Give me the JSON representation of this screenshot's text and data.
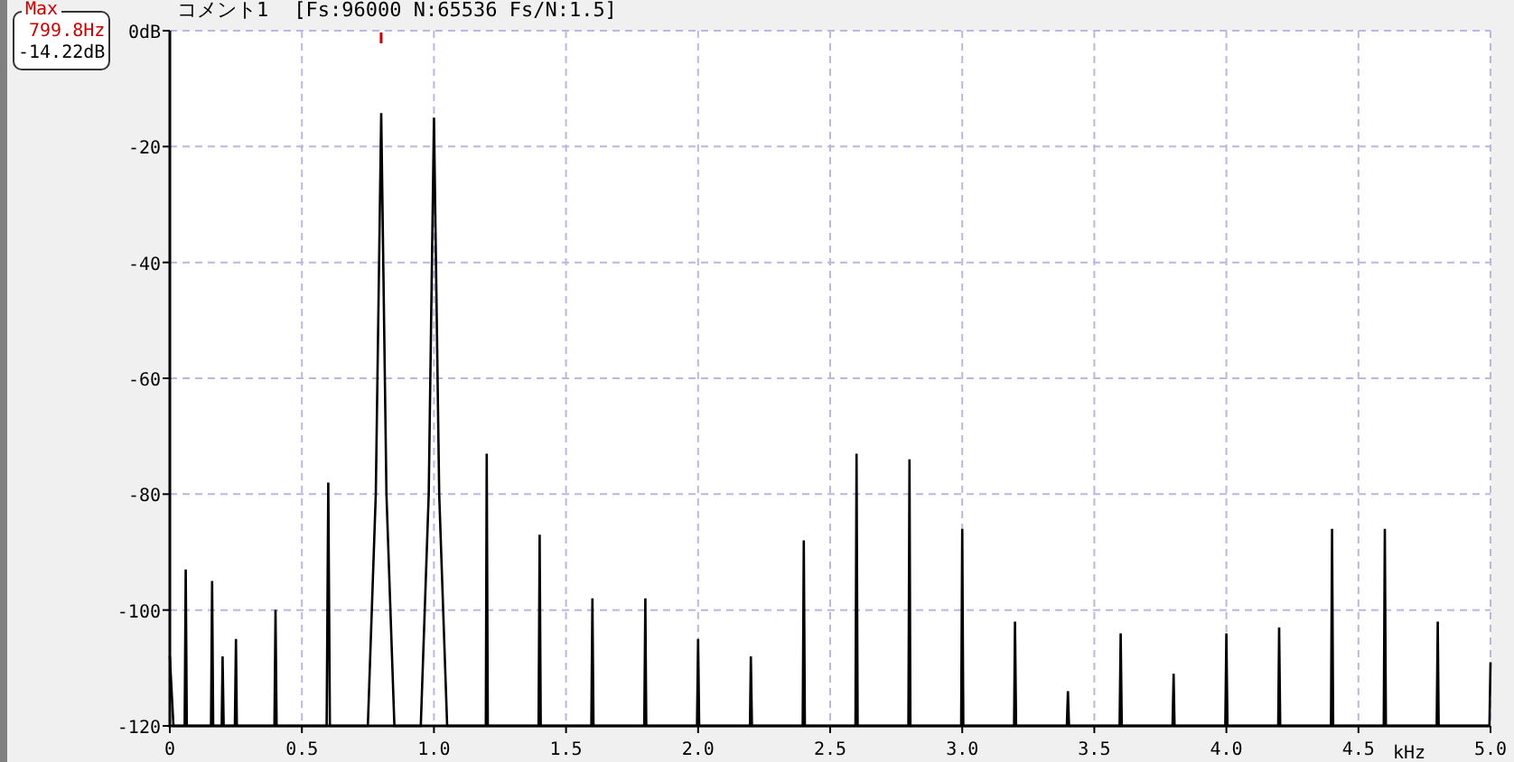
{
  "readout": {
    "label": "Max",
    "frequency": "799.8Hz",
    "level": "-14.22dB"
  },
  "header": {
    "comment": "コメント1",
    "params": "[Fs:96000 N:65536 Fs/N:1.5]"
  },
  "chart_data": {
    "type": "line",
    "xlabel": "kHz",
    "xlim": [
      0,
      5
    ],
    "ylim": [
      -120,
      0
    ],
    "xticks": [
      0,
      0.5,
      {
        "value": 1,
        "label": "1.0"
      },
      1.5,
      {
        "value": 2,
        "label": "2.0"
      },
      2.5,
      {
        "value": 3,
        "label": "3.0"
      },
      3.5,
      {
        "value": 4,
        "label": "4.0"
      },
      4.5,
      {
        "value": 5,
        "label": "5.0"
      }
    ],
    "yticks": [
      {
        "value": 0,
        "label": "0dB"
      },
      -20,
      -40,
      -60,
      -80,
      -100,
      -120
    ],
    "grid": true,
    "x": [
      0,
      0.014,
      0.02,
      0.056,
      0.06,
      0.064,
      0.156,
      0.16,
      0.164,
      0.196,
      0.2,
      0.204,
      0.246,
      0.25,
      0.254,
      0.396,
      0.4,
      0.404,
      0.594,
      0.6,
      0.606,
      0.75,
      0.78,
      0.8,
      0.82,
      0.85,
      0.95,
      0.98,
      1.0,
      1.02,
      1.05,
      1.196,
      1.2,
      1.204,
      1.396,
      1.4,
      1.404,
      1.596,
      1.6,
      1.604,
      1.796,
      1.8,
      1.804,
      1.996,
      2.0,
      2.004,
      2.196,
      2.2,
      2.204,
      2.396,
      2.4,
      2.404,
      2.596,
      2.6,
      2.604,
      2.796,
      2.8,
      2.804,
      2.996,
      3.0,
      3.004,
      3.196,
      3.2,
      3.204,
      3.396,
      3.4,
      3.404,
      3.596,
      3.6,
      3.604,
      3.796,
      3.8,
      3.804,
      3.996,
      4.0,
      4.004,
      4.196,
      4.2,
      4.204,
      4.396,
      4.4,
      4.404,
      4.596,
      4.6,
      4.604,
      4.796,
      4.8,
      4.804,
      4.996,
      5.0
    ],
    "series": [
      {
        "color": "#000000",
        "values": [
          -108,
          -120,
          -120,
          -120,
          -93,
          -120,
          -120,
          -95,
          -120,
          -120,
          -108,
          -120,
          -120,
          -105,
          -120,
          -120,
          -100,
          -120,
          -120,
          -78,
          -120,
          -120,
          -80,
          -14.2,
          -80,
          -120,
          -120,
          -80,
          -15,
          -80,
          -120,
          -120,
          -73,
          -120,
          -120,
          -87,
          -120,
          -120,
          -98,
          -120,
          -120,
          -98,
          -120,
          -120,
          -105,
          -120,
          -120,
          -108,
          -120,
          -120,
          -88,
          -120,
          -120,
          -73,
          -120,
          -120,
          -74,
          -120,
          -120,
          -86,
          -120,
          -120,
          -102,
          -120,
          -120,
          -114,
          -120,
          -120,
          -104,
          -120,
          -120,
          -111,
          -120,
          -120,
          -104,
          -120,
          -120,
          -103,
          -120,
          -120,
          -86,
          -120,
          -120,
          -86,
          -120,
          -120,
          -102,
          -120,
          -120,
          -109
        ]
      }
    ]
  }
}
